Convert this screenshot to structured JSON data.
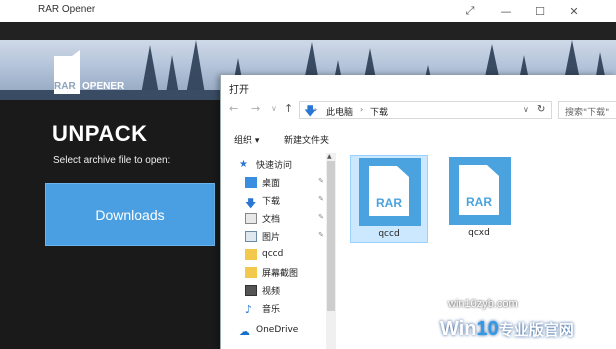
{
  "app": {
    "title": "RAR Opener",
    "logo_left": "RAR",
    "logo_right": "OPENER",
    "heading": "UNPACK",
    "subheading": "Select archive file to open:",
    "downloads_label": "Downloads",
    "window_controls": [
      "maximize-icon",
      "minimize-icon",
      "restore-icon",
      "close-icon"
    ]
  },
  "dialog": {
    "title": "打开",
    "breadcrumb": [
      "此电脑",
      "下载"
    ],
    "search_placeholder": "搜索\"下载\"",
    "toolbar": {
      "organize_label": "组织 ▾",
      "new_folder_label": "新建文件夹"
    },
    "nav": [
      {
        "label": "快速访问",
        "icon": "star-icon",
        "pinned": false
      },
      {
        "label": "桌面",
        "icon": "desktop-icon",
        "pinned": true
      },
      {
        "label": "下载",
        "icon": "download-icon",
        "pinned": true
      },
      {
        "label": "文档",
        "icon": "document-icon",
        "pinned": true
      },
      {
        "label": "图片",
        "icon": "picture-icon",
        "pinned": true
      },
      {
        "label": "qccd",
        "icon": "folder-icon",
        "pinned": false
      },
      {
        "label": "屏幕截图",
        "icon": "folder-icon",
        "pinned": false
      },
      {
        "label": "视频",
        "icon": "video-icon",
        "pinned": false
      },
      {
        "label": "音乐",
        "icon": "music-icon",
        "pinned": false
      },
      {
        "label": "OneDrive",
        "icon": "cloud-icon",
        "pinned": false
      }
    ],
    "files": [
      {
        "name": "qccd",
        "type_label": "RAR",
        "selected": true
      },
      {
        "name": "qcxd",
        "type_label": "RAR",
        "selected": false
      }
    ]
  },
  "watermark": {
    "domain": "win10zyb.com",
    "brand_prefix": "Win",
    "brand_num": "10",
    "brand_cn": "专业版官网"
  },
  "colors": {
    "accent": "#4a9fe2",
    "rar_blue": "#4aa3df",
    "selection": "#cce8ff"
  }
}
